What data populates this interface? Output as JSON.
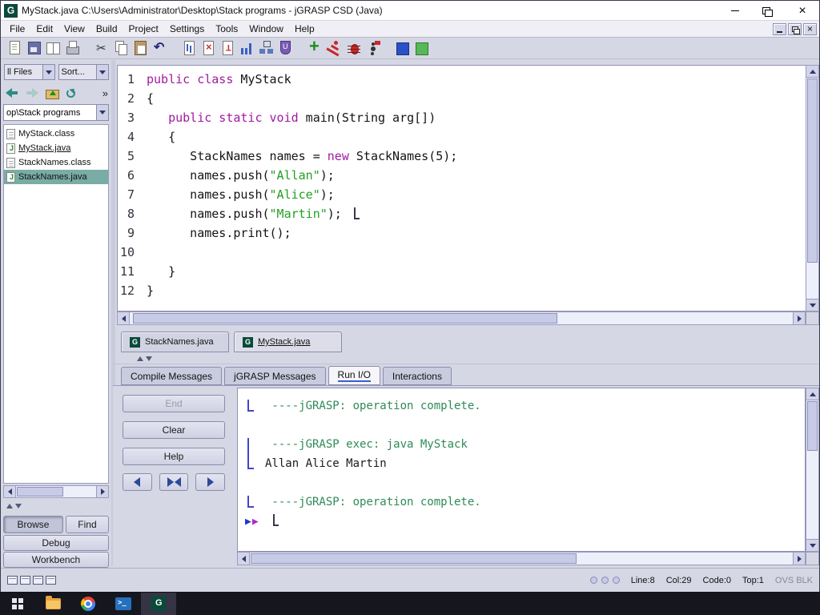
{
  "window": {
    "title": "MyStack.java  C:\\Users\\Administrator\\Desktop\\Stack programs - jGRASP CSD (Java)",
    "logo": "G"
  },
  "menubar": [
    "File",
    "Edit",
    "View",
    "Build",
    "Project",
    "Settings",
    "Tools",
    "Window",
    "Help"
  ],
  "toolbar": [
    {
      "name": "new-file"
    },
    {
      "name": "save"
    },
    {
      "name": "open-file"
    },
    {
      "name": "print"
    },
    {
      "name": "cut",
      "sep": true
    },
    {
      "name": "copy"
    },
    {
      "name": "paste"
    },
    {
      "name": "undo"
    },
    {
      "name": "csd-generate",
      "sep": true
    },
    {
      "name": "csd-remove"
    },
    {
      "name": "number-lines"
    },
    {
      "name": "complexity-profile"
    },
    {
      "name": "uml"
    },
    {
      "name": "documentation"
    },
    {
      "name": "compile",
      "sep": true
    },
    {
      "name": "run"
    },
    {
      "name": "debug"
    },
    {
      "name": "run-applet"
    },
    {
      "name": "interactions",
      "sep": true
    },
    {
      "name": "workbench"
    }
  ],
  "browse": {
    "files_filter": "ll Files",
    "sort_label": "Sort...",
    "path": "op\\Stack programs",
    "files": [
      {
        "name": "MyStack.class",
        "java": false,
        "open": false,
        "selected": false
      },
      {
        "name": "MyStack.java",
        "java": true,
        "open": true,
        "selected": false
      },
      {
        "name": "StackNames.class",
        "java": false,
        "open": false,
        "selected": false
      },
      {
        "name": "StackNames.java",
        "java": true,
        "open": false,
        "selected": true
      }
    ],
    "browse_label": "Browse",
    "find_label": "Find",
    "debug_label": "Debug",
    "workbench_label": "Workbench"
  },
  "editor": {
    "lines": [
      {
        "num": "1",
        "segs": [
          {
            "t": "kw",
            "x": "public class"
          },
          {
            "t": "pl",
            "x": " MyStack"
          }
        ]
      },
      {
        "num": "2",
        "segs": [
          {
            "t": "pl",
            "x": "{"
          }
        ]
      },
      {
        "num": "3",
        "segs": [
          {
            "t": "pl",
            "x": "   "
          },
          {
            "t": "kw",
            "x": "public static void"
          },
          {
            "t": "pl",
            "x": " main(String arg[])"
          }
        ]
      },
      {
        "num": "4",
        "segs": [
          {
            "t": "pl",
            "x": "   {"
          }
        ]
      },
      {
        "num": "5",
        "segs": [
          {
            "t": "pl",
            "x": "      StackNames names = "
          },
          {
            "t": "kw",
            "x": "new"
          },
          {
            "t": "pl",
            "x": " StackNames(5);"
          }
        ]
      },
      {
        "num": "6",
        "segs": [
          {
            "t": "pl",
            "x": "      names.push("
          },
          {
            "t": "str",
            "x": "\"Allan\""
          },
          {
            "t": "pl",
            "x": ");"
          }
        ]
      },
      {
        "num": "7",
        "segs": [
          {
            "t": "pl",
            "x": "      names.push("
          },
          {
            "t": "str",
            "x": "\"Alice\""
          },
          {
            "t": "pl",
            "x": ");"
          }
        ]
      },
      {
        "num": "8",
        "segs": [
          {
            "t": "pl",
            "x": "      names.push("
          },
          {
            "t": "str",
            "x": "\"Martin\""
          },
          {
            "t": "pl",
            "x": "); "
          }
        ],
        "cursor": true
      },
      {
        "num": "9",
        "segs": [
          {
            "t": "pl",
            "x": "      names.print();"
          }
        ]
      },
      {
        "num": "10",
        "segs": []
      },
      {
        "num": "11",
        "segs": [
          {
            "t": "pl",
            "x": "   }"
          }
        ]
      },
      {
        "num": "12",
        "segs": [
          {
            "t": "pl",
            "x": "}"
          }
        ]
      }
    ]
  },
  "open_tabs": [
    {
      "label": "StackNames.java",
      "active": false
    },
    {
      "label": "MyStack.java",
      "active": true
    }
  ],
  "message_tabs": [
    {
      "label": "Compile Messages",
      "active": false
    },
    {
      "label": "jGRASP Messages",
      "active": false
    },
    {
      "label": "Run I/O",
      "active": true
    },
    {
      "label": "Interactions",
      "active": false
    }
  ],
  "run_io": {
    "buttons": [
      {
        "label": "End",
        "disabled": true
      },
      {
        "label": "Clear",
        "disabled": false
      },
      {
        "label": "Help",
        "disabled": false
      }
    ],
    "output": [
      {
        "text": " ----jGRASP: operation complete.",
        "type": "jgrasp",
        "bracket": "single"
      },
      {
        "text": "",
        "type": "plain"
      },
      {
        "text": " ----jGRASP exec: java MyStack",
        "type": "jgrasp",
        "bracket": "tall"
      },
      {
        "text": "Allan Alice Martin",
        "type": "plain"
      },
      {
        "text": "",
        "type": "plain"
      },
      {
        "text": " ----jGRASP: operation complete.",
        "type": "jgrasp",
        "bracket": "single"
      },
      {
        "text": "",
        "type": "prompt"
      }
    ],
    "prompt_glyphs": [
      "▶",
      "▶"
    ]
  },
  "status": {
    "line": "Line:8",
    "col": "Col:29",
    "code": "Code:0",
    "top": "Top:1",
    "mode": "OVS BLK"
  },
  "colors": {
    "keyword": "#a11aa1",
    "string": "#22a022",
    "jgrasp_output": "#2e8b57",
    "file_selection": "#79aca4",
    "bracket_blue": "#4444cc"
  }
}
